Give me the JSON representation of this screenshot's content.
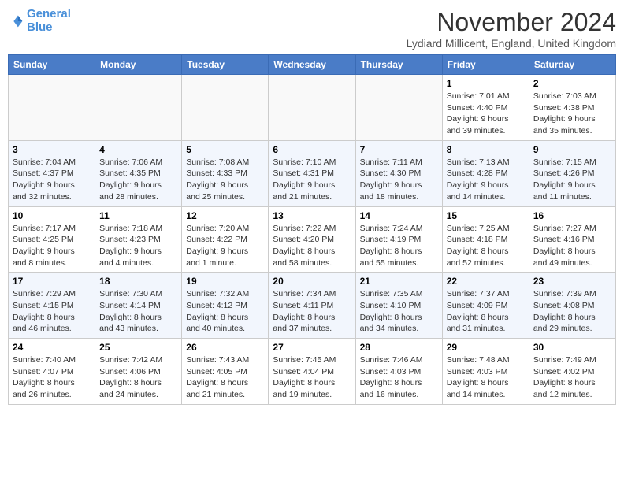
{
  "header": {
    "logo_line1": "General",
    "logo_line2": "Blue",
    "month_title": "November 2024",
    "location": "Lydiard Millicent, England, United Kingdom"
  },
  "weekdays": [
    "Sunday",
    "Monday",
    "Tuesday",
    "Wednesday",
    "Thursday",
    "Friday",
    "Saturday"
  ],
  "weeks": [
    [
      {
        "day": "",
        "info": ""
      },
      {
        "day": "",
        "info": ""
      },
      {
        "day": "",
        "info": ""
      },
      {
        "day": "",
        "info": ""
      },
      {
        "day": "",
        "info": ""
      },
      {
        "day": "1",
        "info": "Sunrise: 7:01 AM\nSunset: 4:40 PM\nDaylight: 9 hours and 39 minutes."
      },
      {
        "day": "2",
        "info": "Sunrise: 7:03 AM\nSunset: 4:38 PM\nDaylight: 9 hours and 35 minutes."
      }
    ],
    [
      {
        "day": "3",
        "info": "Sunrise: 7:04 AM\nSunset: 4:37 PM\nDaylight: 9 hours and 32 minutes."
      },
      {
        "day": "4",
        "info": "Sunrise: 7:06 AM\nSunset: 4:35 PM\nDaylight: 9 hours and 28 minutes."
      },
      {
        "day": "5",
        "info": "Sunrise: 7:08 AM\nSunset: 4:33 PM\nDaylight: 9 hours and 25 minutes."
      },
      {
        "day": "6",
        "info": "Sunrise: 7:10 AM\nSunset: 4:31 PM\nDaylight: 9 hours and 21 minutes."
      },
      {
        "day": "7",
        "info": "Sunrise: 7:11 AM\nSunset: 4:30 PM\nDaylight: 9 hours and 18 minutes."
      },
      {
        "day": "8",
        "info": "Sunrise: 7:13 AM\nSunset: 4:28 PM\nDaylight: 9 hours and 14 minutes."
      },
      {
        "day": "9",
        "info": "Sunrise: 7:15 AM\nSunset: 4:26 PM\nDaylight: 9 hours and 11 minutes."
      }
    ],
    [
      {
        "day": "10",
        "info": "Sunrise: 7:17 AM\nSunset: 4:25 PM\nDaylight: 9 hours and 8 minutes."
      },
      {
        "day": "11",
        "info": "Sunrise: 7:18 AM\nSunset: 4:23 PM\nDaylight: 9 hours and 4 minutes."
      },
      {
        "day": "12",
        "info": "Sunrise: 7:20 AM\nSunset: 4:22 PM\nDaylight: 9 hours and 1 minute."
      },
      {
        "day": "13",
        "info": "Sunrise: 7:22 AM\nSunset: 4:20 PM\nDaylight: 8 hours and 58 minutes."
      },
      {
        "day": "14",
        "info": "Sunrise: 7:24 AM\nSunset: 4:19 PM\nDaylight: 8 hours and 55 minutes."
      },
      {
        "day": "15",
        "info": "Sunrise: 7:25 AM\nSunset: 4:18 PM\nDaylight: 8 hours and 52 minutes."
      },
      {
        "day": "16",
        "info": "Sunrise: 7:27 AM\nSunset: 4:16 PM\nDaylight: 8 hours and 49 minutes."
      }
    ],
    [
      {
        "day": "17",
        "info": "Sunrise: 7:29 AM\nSunset: 4:15 PM\nDaylight: 8 hours and 46 minutes."
      },
      {
        "day": "18",
        "info": "Sunrise: 7:30 AM\nSunset: 4:14 PM\nDaylight: 8 hours and 43 minutes."
      },
      {
        "day": "19",
        "info": "Sunrise: 7:32 AM\nSunset: 4:12 PM\nDaylight: 8 hours and 40 minutes."
      },
      {
        "day": "20",
        "info": "Sunrise: 7:34 AM\nSunset: 4:11 PM\nDaylight: 8 hours and 37 minutes."
      },
      {
        "day": "21",
        "info": "Sunrise: 7:35 AM\nSunset: 4:10 PM\nDaylight: 8 hours and 34 minutes."
      },
      {
        "day": "22",
        "info": "Sunrise: 7:37 AM\nSunset: 4:09 PM\nDaylight: 8 hours and 31 minutes."
      },
      {
        "day": "23",
        "info": "Sunrise: 7:39 AM\nSunset: 4:08 PM\nDaylight: 8 hours and 29 minutes."
      }
    ],
    [
      {
        "day": "24",
        "info": "Sunrise: 7:40 AM\nSunset: 4:07 PM\nDaylight: 8 hours and 26 minutes."
      },
      {
        "day": "25",
        "info": "Sunrise: 7:42 AM\nSunset: 4:06 PM\nDaylight: 8 hours and 24 minutes."
      },
      {
        "day": "26",
        "info": "Sunrise: 7:43 AM\nSunset: 4:05 PM\nDaylight: 8 hours and 21 minutes."
      },
      {
        "day": "27",
        "info": "Sunrise: 7:45 AM\nSunset: 4:04 PM\nDaylight: 8 hours and 19 minutes."
      },
      {
        "day": "28",
        "info": "Sunrise: 7:46 AM\nSunset: 4:03 PM\nDaylight: 8 hours and 16 minutes."
      },
      {
        "day": "29",
        "info": "Sunrise: 7:48 AM\nSunset: 4:03 PM\nDaylight: 8 hours and 14 minutes."
      },
      {
        "day": "30",
        "info": "Sunrise: 7:49 AM\nSunset: 4:02 PM\nDaylight: 8 hours and 12 minutes."
      }
    ]
  ]
}
